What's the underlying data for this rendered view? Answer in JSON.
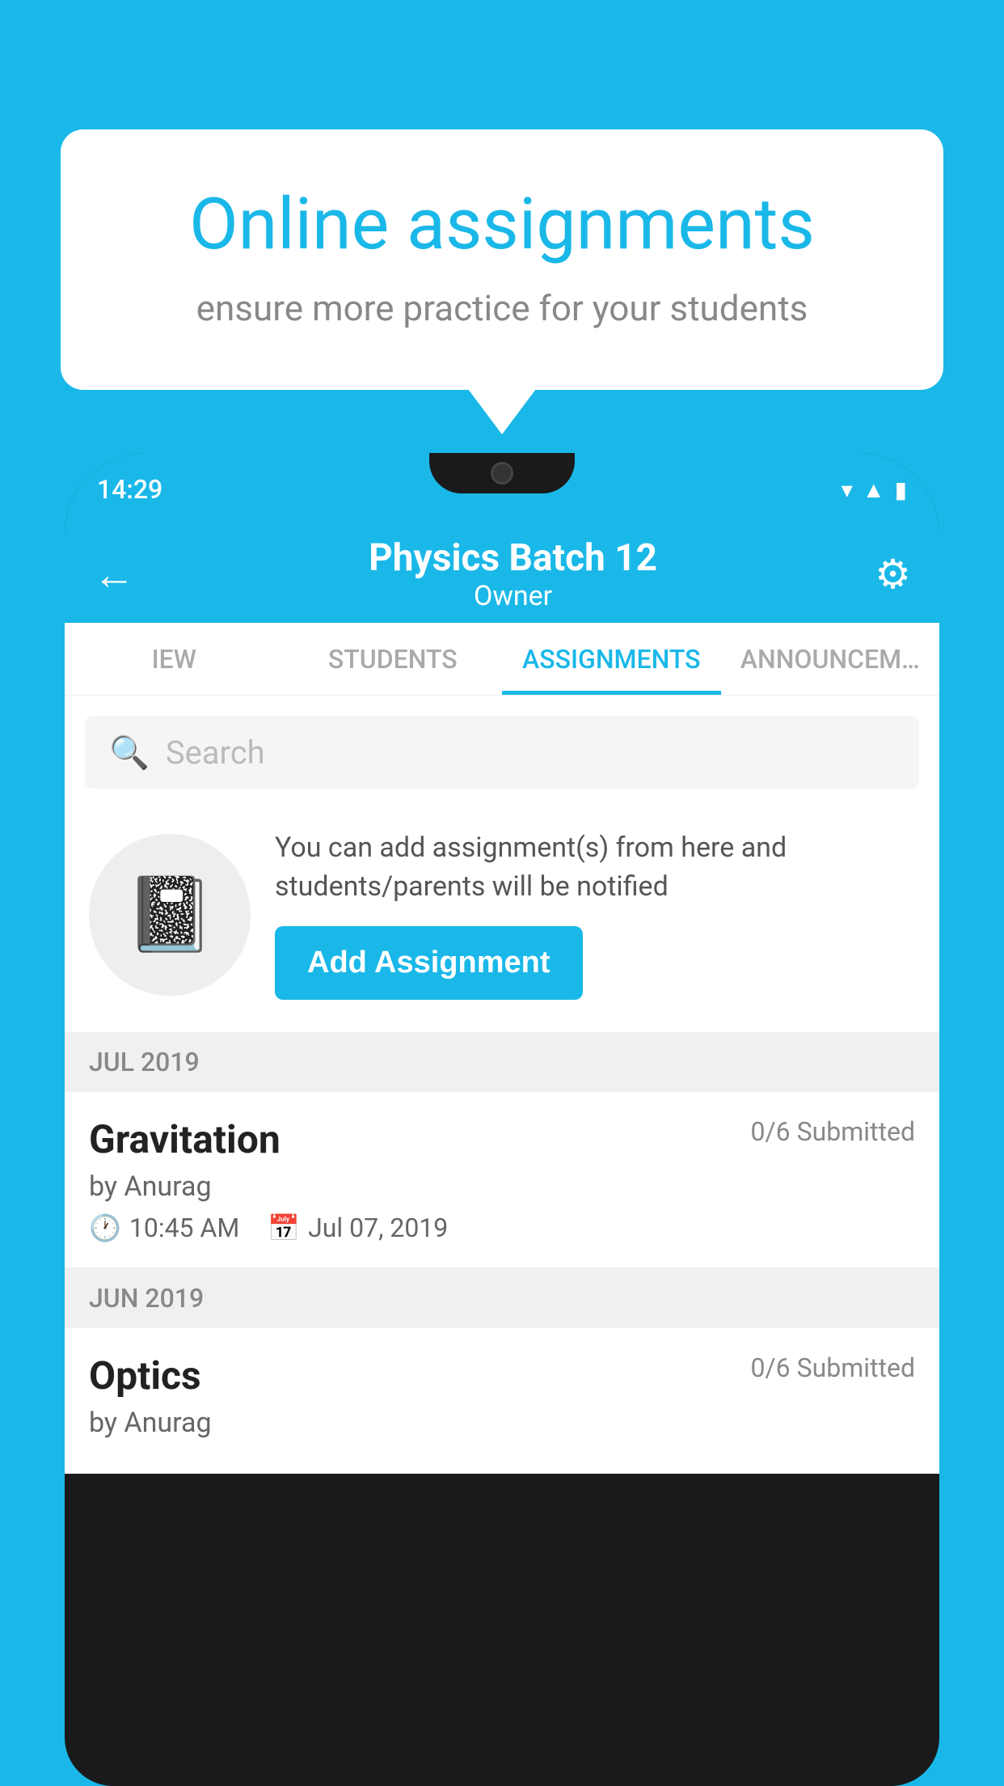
{
  "background": {
    "color": "#1ab8e8"
  },
  "speech_bubble": {
    "title": "Online assignments",
    "subtitle": "ensure more practice for your students"
  },
  "phone": {
    "status_bar": {
      "time": "14:29",
      "wifi_icon": "wifi",
      "signal_icon": "signal",
      "battery_icon": "battery"
    },
    "app_bar": {
      "back_label": "←",
      "title": "Physics Batch 12",
      "subtitle": "Owner",
      "settings_icon": "⚙"
    },
    "tabs": [
      {
        "label": "IEW",
        "active": false
      },
      {
        "label": "STUDENTS",
        "active": false
      },
      {
        "label": "ASSIGNMENTS",
        "active": true
      },
      {
        "label": "ANNOUNCEM…",
        "active": false
      }
    ],
    "search": {
      "placeholder": "Search"
    },
    "promo": {
      "description": "You can add assignment(s) from here and students/parents will be notified",
      "button_label": "Add Assignment"
    },
    "assignment_sections": [
      {
        "month_label": "JUL 2019",
        "assignments": [
          {
            "title": "Gravitation",
            "submitted": "0/6 Submitted",
            "by": "by Anurag",
            "time": "10:45 AM",
            "date": "Jul 07, 2019"
          }
        ]
      },
      {
        "month_label": "JUN 2019",
        "assignments": [
          {
            "title": "Optics",
            "submitted": "0/6 Submitted",
            "by": "by Anurag",
            "time": "",
            "date": ""
          }
        ]
      }
    ]
  }
}
